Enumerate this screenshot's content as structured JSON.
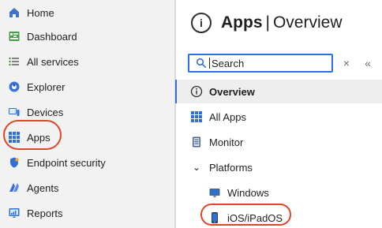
{
  "left_nav": {
    "items": [
      {
        "label": "Home",
        "icon": "home-icon"
      },
      {
        "label": "Dashboard",
        "icon": "dashboard-icon"
      },
      {
        "label": "All services",
        "icon": "list-icon"
      },
      {
        "label": "Explorer",
        "icon": "explorer-icon"
      },
      {
        "label": "Devices",
        "icon": "devices-icon"
      },
      {
        "label": "Apps",
        "icon": "apps-grid-icon"
      },
      {
        "label": "Endpoint security",
        "icon": "shield-icon"
      },
      {
        "label": "Agents",
        "icon": "agents-icon"
      },
      {
        "label": "Reports",
        "icon": "reports-icon"
      }
    ]
  },
  "page": {
    "title_strong": "Apps",
    "title_separator": "|",
    "title_normal": "Overview"
  },
  "search": {
    "placeholder": "Search"
  },
  "section_nav": {
    "items": [
      {
        "label": "Overview",
        "icon": "info-icon"
      },
      {
        "label": "All Apps",
        "icon": "apps-grid-icon"
      },
      {
        "label": "Monitor",
        "icon": "monitor-icon"
      },
      {
        "label": "Platforms",
        "icon": "chevron-down-icon"
      },
      {
        "label": "Windows",
        "icon": "windows-icon"
      },
      {
        "label": "iOS/iPadOS",
        "icon": "mobile-device-icon"
      }
    ]
  },
  "colors": {
    "highlight_red": "#e0442b",
    "accent_blue": "#2f6fe4",
    "nav_bg": "#f2f2f2"
  }
}
